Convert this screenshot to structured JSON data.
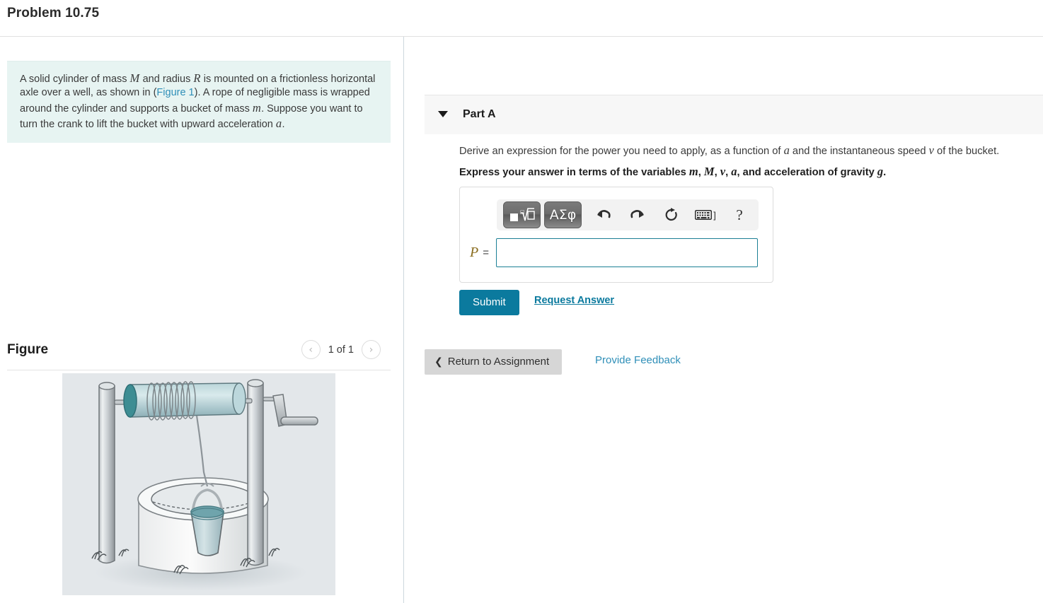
{
  "header": {
    "problem_title": "Problem 10.75"
  },
  "left": {
    "statement": {
      "part1": "A solid cylinder of mass ",
      "var_M": "M",
      "part2": " and radius ",
      "var_R": "R",
      "part3": " is mounted on a frictionless horizontal axle over a well, as shown in (",
      "figure_link": "Figure 1",
      "part4": "). A rope of negligible mass is wrapped around the cylinder and supports a bucket of mass ",
      "var_m": "m",
      "part5": ". Suppose you want to turn the crank to lift the bucket with upward acceleration ",
      "var_a": "a",
      "part6": "."
    },
    "figure": {
      "title": "Figure",
      "pager_label": "1 of 1",
      "prev_icon": "chevron-left-icon",
      "next_icon": "chevron-right-icon",
      "prev_glyph": "‹",
      "next_glyph": "›",
      "alt": "A solid cylinder on a horizontal axle over a stone well with a rope wrapped around it supporting a bucket, with a crank handle on the right post."
    }
  },
  "right": {
    "part": {
      "label": "Part A",
      "caret_icon": "caret-down-icon"
    },
    "question": {
      "line1_a": "Derive an expression for the power you need to apply, as a function of ",
      "line1_var_a": "a",
      "line1_b": " and the instantaneous speed ",
      "line1_var_v": "v",
      "line1_c": " of the bucket.",
      "line2_a": "Express your answer in terms of the variables ",
      "line2_var_m": "m",
      "line2_sep1": ", ",
      "line2_var_M": "M",
      "line2_sep2": ", ",
      "line2_var_v": "v",
      "line2_sep3": ", ",
      "line2_var_a": "a",
      "line2_b": ", and acceleration of gravity ",
      "line2_var_g": "g",
      "line2_c": "."
    },
    "answer": {
      "variable_label": "P",
      "equals": "=",
      "value": "",
      "placeholder": "",
      "toolbar": {
        "template_icon": "math-template-icon",
        "greek_icon": "greek-letters-icon",
        "greek_glyph": "ΑΣφ",
        "undo_icon": "undo-icon",
        "redo_icon": "redo-icon",
        "reset_icon": "reset-icon",
        "keyboard_icon": "keyboard-icon",
        "keyboard_bracket": "]",
        "help_icon": "help-icon",
        "help_glyph": "?"
      }
    },
    "actions": {
      "submit_label": "Submit",
      "request_answer_label": "Request Answer"
    },
    "footer": {
      "return_label": "Return to Assignment",
      "return_icon": "chevron-left-icon",
      "return_glyph": "❮",
      "feedback_label": "Provide Feedback"
    }
  },
  "colors": {
    "accent_teal": "#0b7a9e",
    "link_blue": "#2f8fb8",
    "statement_bg": "#e7f4f2",
    "part_header_bg": "#f7f7f7",
    "figure_bg": "#e3e7ea",
    "return_btn_bg": "#d6d6d6",
    "input_border": "#1b7f95"
  }
}
